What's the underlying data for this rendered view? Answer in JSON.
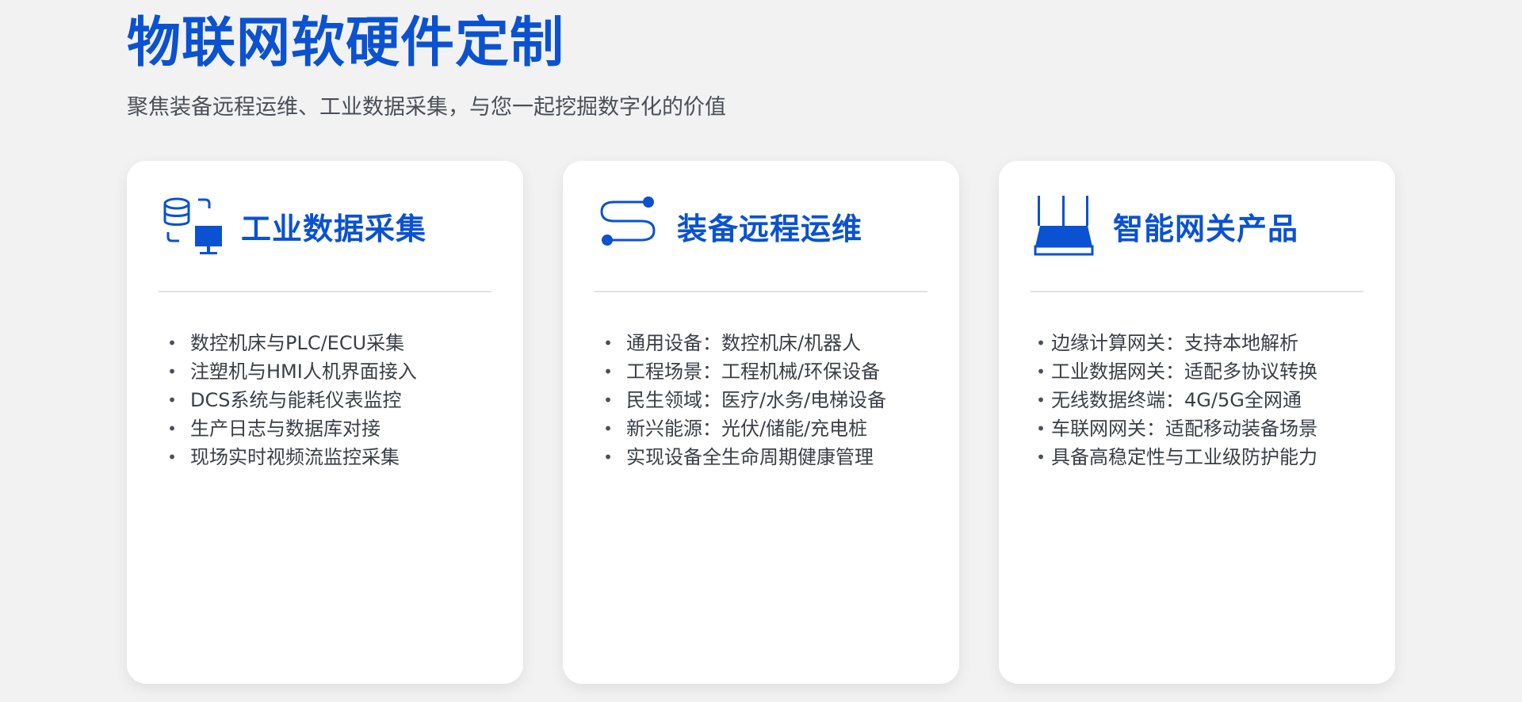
{
  "page": {
    "title": "物联网软硬件定制",
    "subtitle": "聚焦装备远程运维、工业数据采集，与您一起挖掘数字化的价值"
  },
  "colors": {
    "brand_blue": "#0a52d1",
    "background": "#f2f2f2",
    "card_background": "#ffffff",
    "text": "#3a3f47"
  },
  "cards": [
    {
      "icon": "data-collection-icon",
      "title": "工业数据采集",
      "items": [
        "数控机床与PLC/ECU采集",
        "注塑机与HMI人机界面接入",
        "DCS系统与能耗仪表监控",
        "生产日志与数据库对接",
        "现场实时视频流监控采集"
      ]
    },
    {
      "icon": "route-path-icon",
      "title": "装备远程运维",
      "items": [
        "通用设备：数控机床/机器人",
        "工程场景：工程机械/环保设备",
        "民生领域：医疗/水务/电梯设备",
        "新兴能源：光伏/储能/充电桩",
        "实现设备全生命周期健康管理"
      ]
    },
    {
      "icon": "router-icon",
      "title": "智能网关产品",
      "items": [
        "边缘计算网关：支持本地解析",
        "工业数据网关：适配多协议转换",
        "无线数据终端：4G/5G全网通",
        "车联网网关：适配移动装备场景",
        "具备高稳定性与工业级防护能力"
      ]
    }
  ]
}
